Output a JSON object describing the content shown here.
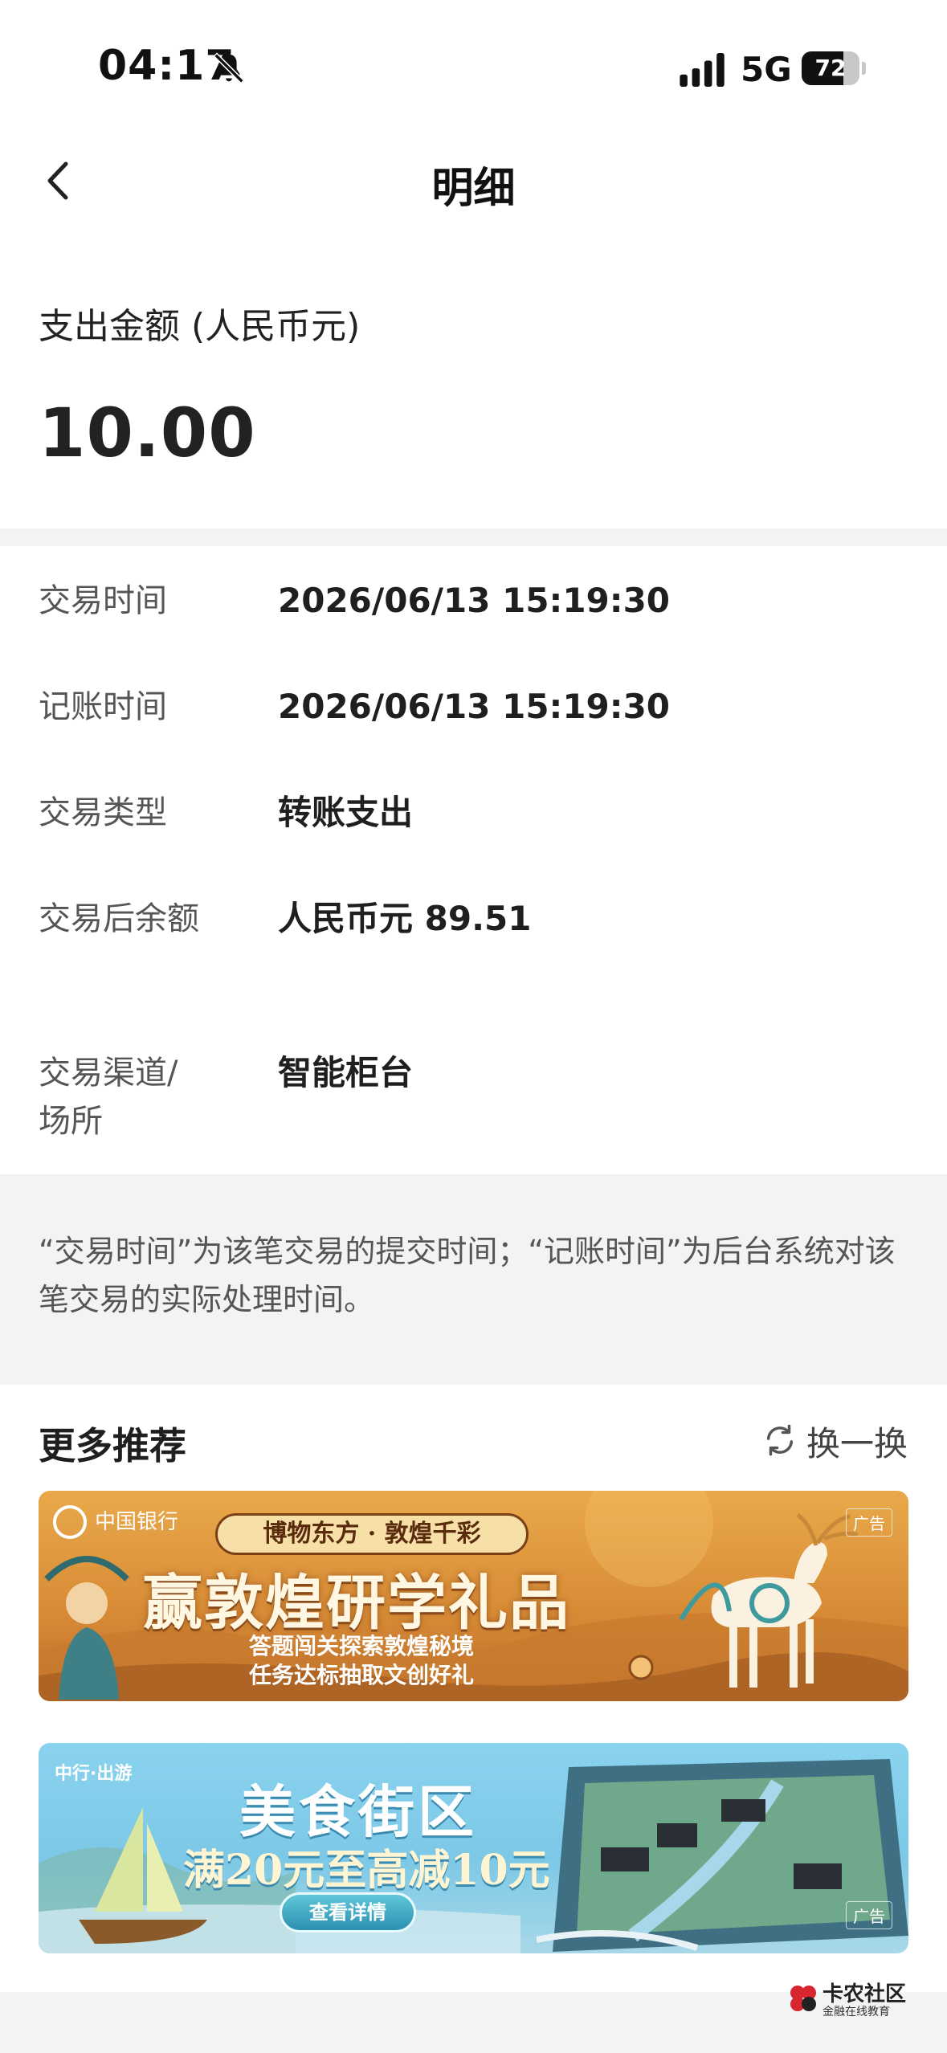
{
  "status_bar": {
    "time": "04:17",
    "network": "5G",
    "battery": "72",
    "battery_level": 0.72
  },
  "nav": {
    "title": "明细"
  },
  "amount": {
    "label": "支出金额 (人民币元)",
    "value": "10.00"
  },
  "details": [
    {
      "label": "交易时间",
      "value": "2026/06/13 15:19:30"
    },
    {
      "label": "记账时间",
      "value": "2026/06/13 15:19:30"
    },
    {
      "label": "交易类型",
      "value": "转账支出"
    },
    {
      "label": "交易后余额",
      "value": "人民币元 89.51"
    },
    {
      "label": "交易渠道/场所",
      "value": "智能柜台"
    }
  ],
  "note": "“交易时间”为该笔交易的提交时间；“记账时间”为后台系统对该笔交易的实际处理时间。",
  "recommend": {
    "title": "更多推荐",
    "refresh_label": "换一换",
    "banners": [
      {
        "logo": "中国银行",
        "ribbon": "博物东方 · 敦煌千彩",
        "headline": "赢敦煌研学礼品",
        "sub1": "答题闯关探索敦煌秘境",
        "sub2": "任务达标抽取文创好礼",
        "ad": "广告"
      },
      {
        "logo": "中行·出游",
        "title": "美食街区",
        "sub": "满20元至高减10元",
        "button": "查看详情",
        "ad": "广告"
      }
    ]
  },
  "watermark": {
    "title": "卡农社区",
    "sub": "金融在线教育"
  },
  "colors": {
    "background": "#ffffff",
    "band": "#f3f3f3",
    "label": "#555555",
    "value": "#1f1f1f"
  }
}
